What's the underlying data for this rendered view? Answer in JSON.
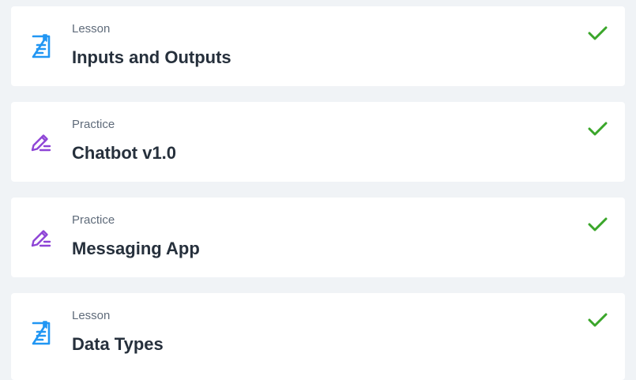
{
  "items": [
    {
      "kind": "Lesson",
      "title": "Inputs and Outputs",
      "icon": "lesson-document-icon",
      "status_icon": "checkmark-icon",
      "completed": true
    },
    {
      "kind": "Practice",
      "title": "Chatbot v1.0",
      "icon": "practice-pencil-icon",
      "status_icon": "checkmark-icon",
      "completed": true
    },
    {
      "kind": "Practice",
      "title": "Messaging App",
      "icon": "practice-pencil-icon",
      "status_icon": "checkmark-icon",
      "completed": true
    },
    {
      "kind": "Lesson",
      "title": "Data Types",
      "icon": "lesson-document-icon",
      "status_icon": "checkmark-icon",
      "completed": true
    }
  ],
  "colors": {
    "lesson_icon": "#2196f3",
    "practice_icon": "#8e44d6",
    "check": "#3aa62a",
    "page_background": "#f0f3f6",
    "card_background": "#ffffff",
    "title_text": "#26303c",
    "kind_text": "#5f6b7a"
  }
}
